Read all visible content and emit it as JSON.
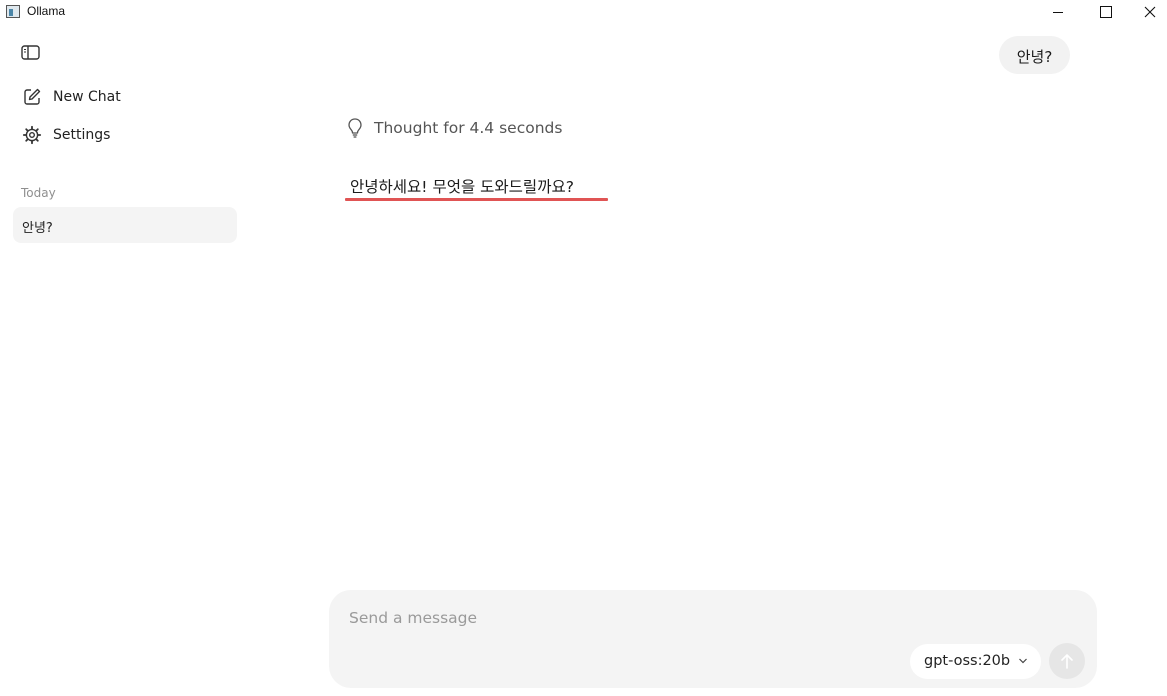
{
  "window": {
    "title": "Ollama"
  },
  "sidebar": {
    "toggle_icon": "sidebar-toggle-icon",
    "items": [
      {
        "label": "New Chat",
        "icon": "edit-icon"
      },
      {
        "label": "Settings",
        "icon": "gear-icon"
      }
    ],
    "section_label": "Today",
    "chats": [
      {
        "label": "안녕?"
      }
    ]
  },
  "conversation": {
    "user_message": "안녕?",
    "thought_label": "Thought for 4.4 seconds",
    "assistant_message": "안녕하세요! 무엇을 도와드릴까요?",
    "highlight_color": "#e05454"
  },
  "composer": {
    "placeholder": "Send a message",
    "model": "gpt-oss:20b",
    "send_icon": "arrow-up-icon"
  }
}
